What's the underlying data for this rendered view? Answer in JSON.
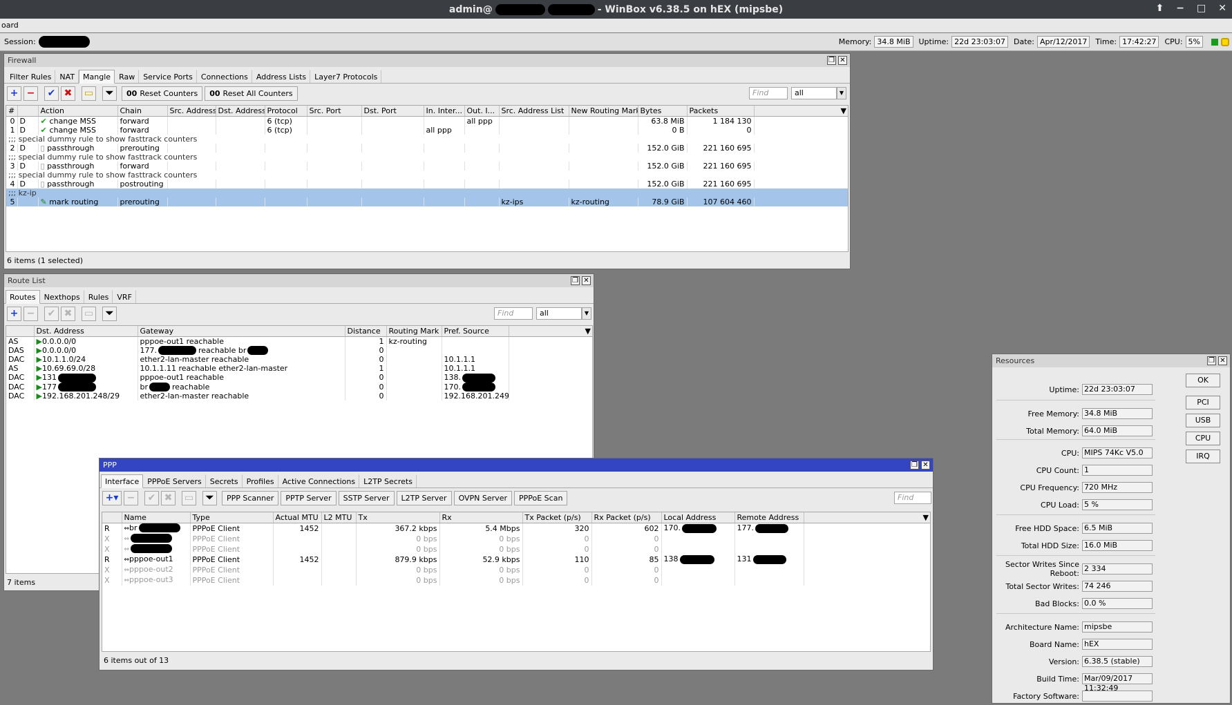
{
  "window": {
    "title_prefix": "admin@",
    "title_suffix": "- WinBox v6.38.5 on hEX (mipsbe)",
    "menu_label": "oard"
  },
  "session": {
    "label": "Session:",
    "memory_label": "Memory:",
    "memory": "34.8 MiB",
    "uptime_label": "Uptime:",
    "uptime": "22d 23:03:07",
    "date_label": "Date:",
    "date": "Apr/12/2017",
    "time_label": "Time:",
    "time": "17:42:27",
    "cpu_label": "CPU:",
    "cpu": "5%"
  },
  "firewall": {
    "title": "Firewall",
    "tabs": [
      "Filter Rules",
      "NAT",
      "Mangle",
      "Raw",
      "Service Ports",
      "Connections",
      "Address Lists",
      "Layer7 Protocols"
    ],
    "reset_counters": "Reset Counters",
    "reset_all_counters": "Reset All Counters",
    "find_placeholder": "Find",
    "filter_value": "all",
    "columns": [
      "#",
      "Action",
      "Chain",
      "Src. Address",
      "Dst. Address",
      "Protocol",
      "Src. Port",
      "Dst. Port",
      "In. Inter...",
      "Out. I...",
      "Src. Address List",
      "New Routing Mark",
      "Bytes",
      "Packets"
    ],
    "rows": [
      {
        "num": "0",
        "flag": "D",
        "action": "change MSS",
        "chain": "forward",
        "protocol": "6 (tcp)",
        "in_iface": "",
        "out_iface": "all ppp",
        "src_list": "",
        "routing_mark": "",
        "bytes": "63.8 MiB",
        "packets": "1 184 130"
      },
      {
        "num": "1",
        "flag": "D",
        "action": "change MSS",
        "chain": "forward",
        "protocol": "6 (tcp)",
        "in_iface": "all ppp",
        "out_iface": "",
        "src_list": "",
        "routing_mark": "",
        "bytes": "0 B",
        "packets": "0"
      },
      {
        "comment": ";;; special dummy rule to show fasttrack counters"
      },
      {
        "num": "2",
        "flag": "D",
        "action": "passthrough",
        "chain": "prerouting",
        "protocol": "",
        "in_iface": "",
        "out_iface": "",
        "src_list": "",
        "routing_mark": "",
        "bytes": "152.0 GiB",
        "packets": "221 160 695"
      },
      {
        "comment": ";;; special dummy rule to show fasttrack counters"
      },
      {
        "num": "3",
        "flag": "D",
        "action": "passthrough",
        "chain": "forward",
        "protocol": "",
        "in_iface": "",
        "out_iface": "",
        "src_list": "",
        "routing_mark": "",
        "bytes": "152.0 GiB",
        "packets": "221 160 695"
      },
      {
        "comment": ";;; special dummy rule to show fasttrack counters"
      },
      {
        "num": "4",
        "flag": "D",
        "action": "passthrough",
        "chain": "postrouting",
        "protocol": "",
        "in_iface": "",
        "out_iface": "",
        "src_list": "",
        "routing_mark": "",
        "bytes": "152.0 GiB",
        "packets": "221 160 695"
      },
      {
        "comment": ";;; kz-ip",
        "selected": true
      },
      {
        "num": "5",
        "flag": "",
        "action": "mark routing",
        "chain": "prerouting",
        "protocol": "",
        "in_iface": "",
        "out_iface": "",
        "src_list": "kz-ips",
        "routing_mark": "kz-routing",
        "bytes": "78.9 GiB",
        "packets": "107 604 460",
        "selected": true
      }
    ],
    "status": "6 items (1 selected)"
  },
  "routes": {
    "title": "Route List",
    "tabs": [
      "Routes",
      "Nexthops",
      "Rules",
      "VRF"
    ],
    "find_placeholder": "Find",
    "filter_value": "all",
    "columns": [
      "",
      "Dst. Address",
      "Gateway",
      "Distance",
      "Routing Mark",
      "Pref. Source"
    ],
    "rows": [
      {
        "flags": "AS",
        "dst": "0.0.0.0/0",
        "gateway": "pppoe-out1 reachable",
        "distance": "1",
        "mark": "kz-routing",
        "pref": ""
      },
      {
        "flags": "DAS",
        "dst": "0.0.0.0/0",
        "gateway": "177.",
        "gateway_tail": "reachable br",
        "distance": "0",
        "mark": "",
        "pref": ""
      },
      {
        "flags": "DAC",
        "dst": "10.1.1.0/24",
        "gateway": "ether2-lan-master reachable",
        "distance": "0",
        "mark": "",
        "pref": "10.1.1.1"
      },
      {
        "flags": "AS",
        "dst": "10.69.69.0/28",
        "gateway": "10.1.1.11 reachable ether2-lan-master",
        "distance": "1",
        "mark": "",
        "pref": "10.1.1.1"
      },
      {
        "flags": "DAC",
        "dst": "131",
        "gateway": "pppoe-out1 reachable",
        "distance": "0",
        "mark": "",
        "pref": "138."
      },
      {
        "flags": "DAC",
        "dst": "177",
        "gateway": "br",
        "gateway_tail": "reachable",
        "distance": "0",
        "mark": "",
        "pref": "170."
      },
      {
        "flags": "DAC",
        "dst": "192.168.201.248/29",
        "gateway": "ether2-lan-master reachable",
        "distance": "0",
        "mark": "",
        "pref": "192.168.201.249"
      }
    ],
    "status": "7 items"
  },
  "ppp": {
    "title": "PPP",
    "tabs": [
      "Interface",
      "PPPoE Servers",
      "Secrets",
      "Profiles",
      "Active Connections",
      "L2TP Secrets"
    ],
    "buttons": [
      "PPP Scanner",
      "PPTP Server",
      "SSTP Server",
      "L2TP Server",
      "OVPN Server",
      "PPPoE Scan"
    ],
    "find_placeholder": "Find",
    "columns": [
      "",
      "Name",
      "Type",
      "Actual MTU",
      "L2 MTU",
      "Tx",
      "Rx",
      "Tx Packet (p/s)",
      "Rx Packet (p/s)",
      "Local Address",
      "Remote Address"
    ],
    "rows": [
      {
        "flag": "R",
        "name": "br",
        "type": "PPPoE Client",
        "mtu": "1452",
        "l2mtu": "",
        "tx": "367.2 kbps",
        "rx": "5.4 Mbps",
        "txp": "320",
        "rxp": "602",
        "local": "170.",
        "remote": "177.",
        "disabled": false
      },
      {
        "flag": "X",
        "name": "",
        "type": "PPPoE Client",
        "mtu": "",
        "l2mtu": "",
        "tx": "0 bps",
        "rx": "0 bps",
        "txp": "0",
        "rxp": "0",
        "local": "",
        "remote": "",
        "disabled": true
      },
      {
        "flag": "X",
        "name": "",
        "type": "PPPoE Client",
        "mtu": "",
        "l2mtu": "",
        "tx": "0 bps",
        "rx": "0 bps",
        "txp": "0",
        "rxp": "0",
        "local": "",
        "remote": "",
        "disabled": true
      },
      {
        "flag": "R",
        "name": "pppoe-out1",
        "type": "PPPoE Client",
        "mtu": "1452",
        "l2mtu": "",
        "tx": "879.9 kbps",
        "rx": "52.9 kbps",
        "txp": "110",
        "rxp": "85",
        "local": "138",
        "remote": "131",
        "disabled": false
      },
      {
        "flag": "X",
        "name": "pppoe-out2",
        "type": "PPPoE Client",
        "mtu": "",
        "l2mtu": "",
        "tx": "0 bps",
        "rx": "0 bps",
        "txp": "0",
        "rxp": "0",
        "local": "",
        "remote": "",
        "disabled": true
      },
      {
        "flag": "X",
        "name": "pppoe-out3",
        "type": "PPPoE Client",
        "mtu": "",
        "l2mtu": "",
        "tx": "0 bps",
        "rx": "0 bps",
        "txp": "0",
        "rxp": "0",
        "local": "",
        "remote": "",
        "disabled": true
      }
    ],
    "status": "6 items out of 13"
  },
  "resources": {
    "title": "Resources",
    "fields": [
      {
        "label": "Uptime:",
        "value": "22d 23:03:07"
      },
      {
        "label": "Free Memory:",
        "value": "34.8 MiB"
      },
      {
        "label": "Total Memory:",
        "value": "64.0 MiB"
      },
      {
        "label": "CPU:",
        "value": "MIPS 74Kc V5.0"
      },
      {
        "label": "CPU Count:",
        "value": "1"
      },
      {
        "label": "CPU Frequency:",
        "value": "720 MHz"
      },
      {
        "label": "CPU Load:",
        "value": "5 %"
      },
      {
        "label": "Free HDD Space:",
        "value": "6.5 MiB"
      },
      {
        "label": "Total HDD Size:",
        "value": "16.0 MiB"
      },
      {
        "label": "Sector Writes Since Reboot:",
        "value": "2 334"
      },
      {
        "label": "Total Sector Writes:",
        "value": "74 246"
      },
      {
        "label": "Bad Blocks:",
        "value": "0.0 %"
      },
      {
        "label": "Architecture Name:",
        "value": "mipsbe"
      },
      {
        "label": "Board Name:",
        "value": "hEX"
      },
      {
        "label": "Version:",
        "value": "6.38.5 (stable)"
      },
      {
        "label": "Build Time:",
        "value": "Mar/09/2017 11:32:49"
      },
      {
        "label": "Factory Software:",
        "value": ""
      }
    ],
    "buttons": [
      "OK",
      "PCI",
      "USB",
      "CPU",
      "IRQ"
    ]
  }
}
